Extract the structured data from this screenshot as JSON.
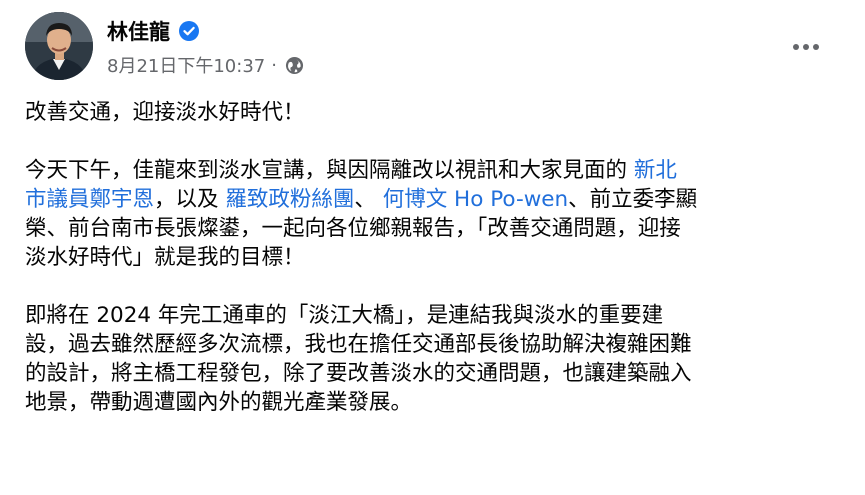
{
  "post": {
    "author": "林佳龍",
    "timestamp": "8月21日下午10:37",
    "separator": "·",
    "title": "改善交通，迎接淡水好時代！",
    "p1": {
      "l1a": "今天下午，佳龍來到淡水宣講，與因隔離改以視訊和大家見面的 ",
      "tag1a": "新北",
      "tag1b": "市議員鄭宇恩",
      "l2a": "，以及 ",
      "tag2": "羅致政粉絲團",
      "l2b": "、 ",
      "tag3": "何博文 Ho Po-wen",
      "l2c": "、前立委李顯",
      "l3": "榮、前台南市長張燦鍙，一起向各位鄉親報告，「改善交通問題，迎接",
      "l4": "淡水好時代」就是我的目標！"
    },
    "p2": {
      "l1": "即將在 2024 年完工通車的「淡江大橋」，是連結我與淡水的重要建",
      "l2": "設，過去雖然歷經多次流標，我也在擔任交通部長後協助解決複雜困難",
      "l3": "的設計，將主橋工程發包，除了要改善淡水的交通問題，也讓建築融入",
      "l4": "地景，帶動週遭國內外的觀光產業發展。"
    }
  },
  "icons": {
    "verified": "verified-badge-icon",
    "privacy": "globe-icon",
    "more": "more-options-icon"
  },
  "colors": {
    "link": "#216fdb",
    "verified": "#1877f2",
    "meta": "#65676b"
  }
}
